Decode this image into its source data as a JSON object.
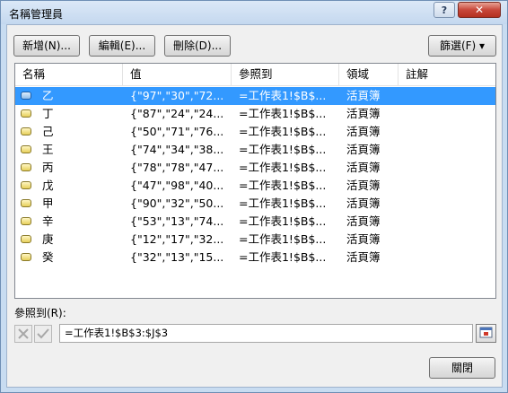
{
  "window": {
    "title": "名稱管理員",
    "help": "?",
    "close": "✕"
  },
  "toolbar": {
    "new_label": "新增(N)...",
    "edit_label": "編輯(E)...",
    "delete_label": "刪除(D)...",
    "filter_label": "篩選(F) ▾"
  },
  "columns": [
    "名稱",
    "值",
    "參照到",
    "領域",
    "註解"
  ],
  "rows": [
    {
      "name": "乙",
      "value": "{\"97\",\"30\",\"72...",
      "ref": "=工作表1!$B$...",
      "scope": "活頁簿",
      "comment": ""
    },
    {
      "name": "丁",
      "value": "{\"87\",\"24\",\"24...",
      "ref": "=工作表1!$B$...",
      "scope": "活頁簿",
      "comment": ""
    },
    {
      "name": "己",
      "value": "{\"50\",\"71\",\"76...",
      "ref": "=工作表1!$B$...",
      "scope": "活頁簿",
      "comment": ""
    },
    {
      "name": "王",
      "value": "{\"74\",\"34\",\"38...",
      "ref": "=工作表1!$B$...",
      "scope": "活頁簿",
      "comment": ""
    },
    {
      "name": "丙",
      "value": "{\"78\",\"78\",\"47...",
      "ref": "=工作表1!$B$...",
      "scope": "活頁簿",
      "comment": ""
    },
    {
      "name": "戊",
      "value": "{\"47\",\"98\",\"40...",
      "ref": "=工作表1!$B$...",
      "scope": "活頁簿",
      "comment": ""
    },
    {
      "name": "甲",
      "value": "{\"90\",\"32\",\"50...",
      "ref": "=工作表1!$B$...",
      "scope": "活頁簿",
      "comment": ""
    },
    {
      "name": "辛",
      "value": "{\"53\",\"13\",\"74...",
      "ref": "=工作表1!$B$...",
      "scope": "活頁簿",
      "comment": ""
    },
    {
      "name": "庚",
      "value": "{\"12\",\"17\",\"32...",
      "ref": "=工作表1!$B$...",
      "scope": "活頁簿",
      "comment": ""
    },
    {
      "name": "癸",
      "value": "{\"32\",\"13\",\"15...",
      "ref": "=工作表1!$B$...",
      "scope": "活頁簿",
      "comment": ""
    }
  ],
  "selected_row": 0,
  "refers_to": {
    "label": "參照到(R):",
    "value": "=工作表1!$B$3:$J$3"
  },
  "footer": {
    "close_label": "關閉"
  },
  "colors": {
    "selection": "#3399ff",
    "title_bar": "#c8dcf1",
    "close_button": "#c8473a"
  }
}
